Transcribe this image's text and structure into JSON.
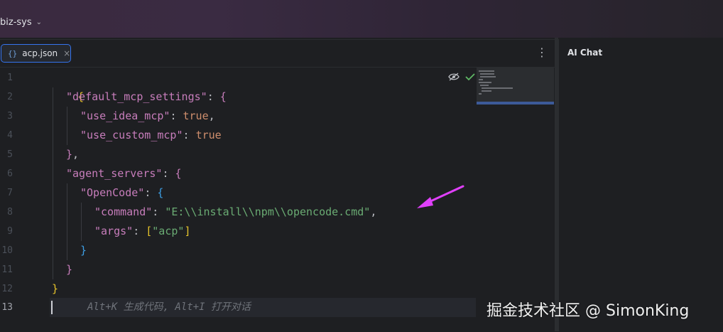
{
  "title_bar": {
    "project_name": "biz-sys"
  },
  "editor": {
    "tab": {
      "icon": "json-braces-icon",
      "icon_text": "{}",
      "label": "acp.json",
      "close_glyph": "×"
    },
    "menu_glyph": "⋮",
    "line_numbers": [
      "1",
      "2",
      "3",
      "4",
      "5",
      "6",
      "7",
      "8",
      "9",
      "10",
      "11",
      "12",
      "13"
    ],
    "code": {
      "l1_open": "{",
      "l2_key": "\"default_mcp_settings\"",
      "l2_colon": ": ",
      "l2_open": "{",
      "l3_key": "\"use_idea_mcp\"",
      "l3_colon": ": ",
      "l3_val": "true",
      "l3_comma": ",",
      "l4_key": "\"use_custom_mcp\"",
      "l4_colon": ": ",
      "l4_val": "true",
      "l5_close": "}",
      "l5_comma": ",",
      "l6_key": "\"agent_servers\"",
      "l6_colon": ": ",
      "l6_open": "{",
      "l7_key": "\"OpenCode\"",
      "l7_colon": ": ",
      "l7_open": "{",
      "l8_key": "\"command\"",
      "l8_colon": ": ",
      "l8_val": "\"E:\\\\install\\\\npm\\\\opencode.cmd\"",
      "l8_comma": ",",
      "l9_key": "\"args\"",
      "l9_colon": ": ",
      "l9_open": "[",
      "l9_val": "\"acp\"",
      "l9_close": "]",
      "l10_close": "}",
      "l11_close": "}",
      "l12_close": "}"
    },
    "inline_hint": "Alt+K 生成代码, Alt+I 打开对话"
  },
  "right_panel": {
    "title": "AI Chat"
  },
  "watermark": "掘金技术社区 @ SimonKing",
  "colors": {
    "background": "#1e1f22",
    "string": "#6aab73",
    "keyword_value": "#cf8e6d",
    "accent": "#3574f0",
    "annotation_arrow": "#e040fb"
  }
}
